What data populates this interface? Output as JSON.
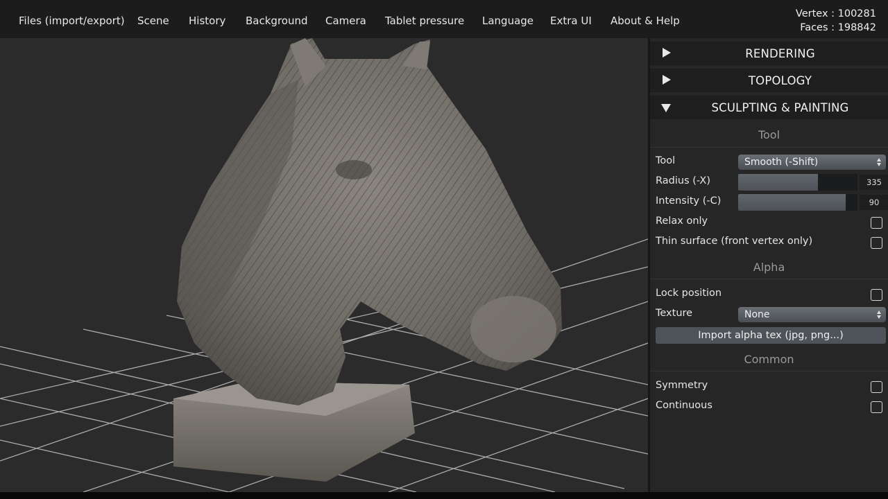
{
  "menu": {
    "items": [
      {
        "label": "Files (import/export)"
      },
      {
        "label": "Scene"
      },
      {
        "label": "History"
      },
      {
        "label": "Background"
      },
      {
        "label": "Camera"
      },
      {
        "label": "Tablet pressure"
      },
      {
        "label": "Language"
      },
      {
        "label": "Extra UI"
      },
      {
        "label": "About & Help"
      }
    ]
  },
  "stats": {
    "vertex": "Vertex : 100281",
    "faces": "Faces : 198842"
  },
  "viewport": {
    "background_color": "#2b2b2b",
    "model_color": "#6b6761"
  },
  "panel": {
    "sections": [
      {
        "label": "RENDERING",
        "expanded": false
      },
      {
        "label": "TOPOLOGY",
        "expanded": false
      },
      {
        "label": "SCULPTING & PAINTING",
        "expanded": true
      }
    ],
    "tool_group": {
      "title": "Tool",
      "tool": {
        "label": "Tool",
        "value": "Smooth (-Shift)"
      },
      "radius": {
        "label": "Radius (-X)",
        "value": "335",
        "fraction": 0.67
      },
      "intensity": {
        "label": "Intensity (-C)",
        "value": "90",
        "fraction": 0.9
      },
      "relax_only": {
        "label": "Relax only",
        "checked": false
      },
      "thin_surface": {
        "label": "Thin surface (front vertex only)",
        "checked": false
      }
    },
    "alpha_group": {
      "title": "Alpha",
      "lock_position": {
        "label": "Lock position",
        "checked": false
      },
      "texture": {
        "label": "Texture",
        "value": "None"
      },
      "import_button": "Import alpha tex (jpg, png...)"
    },
    "common_group": {
      "title": "Common",
      "symmetry": {
        "label": "Symmetry",
        "checked": false
      },
      "continuous": {
        "label": "Continuous",
        "checked": false
      }
    }
  }
}
